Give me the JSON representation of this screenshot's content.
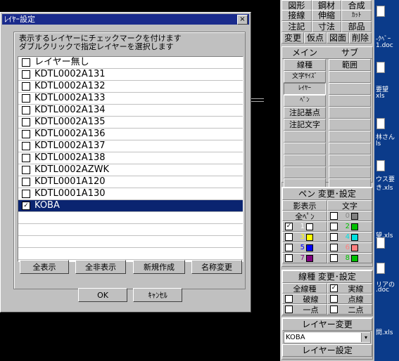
{
  "dialog": {
    "title": "ﾚｲﾔｰ設定",
    "close_label": "×",
    "instructions": [
      "表示するレイヤーにチェックマークを付けます",
      "ダブルクリックで指定レイヤーを選択します"
    ],
    "layers": [
      {
        "name": "レイヤー無し",
        "checked": false,
        "selected": false
      },
      {
        "name": "KDTL0002A131",
        "checked": false,
        "selected": false
      },
      {
        "name": "KDTL0002A132",
        "checked": false,
        "selected": false
      },
      {
        "name": "KDTL0002A133",
        "checked": false,
        "selected": false
      },
      {
        "name": "KDTL0002A134",
        "checked": false,
        "selected": false
      },
      {
        "name": "KDTL0002A135",
        "checked": false,
        "selected": false
      },
      {
        "name": "KDTL0002A136",
        "checked": false,
        "selected": false
      },
      {
        "name": "KDTL0002A137",
        "checked": false,
        "selected": false
      },
      {
        "name": "KDTL0002A138",
        "checked": false,
        "selected": false
      },
      {
        "name": "KDTL0002AZWK",
        "checked": false,
        "selected": false
      },
      {
        "name": "KDTL0001A120",
        "checked": false,
        "selected": false
      },
      {
        "name": "KDTL0001A130",
        "checked": false,
        "selected": false
      },
      {
        "name": "KOBA",
        "checked": true,
        "selected": true
      }
    ],
    "buttons": {
      "show_all": "全表示",
      "hide_all": "全非表示",
      "new": "新規作成",
      "rename": "名称変更",
      "ok": "OK",
      "cancel": "ｷｬﾝｾﾙ"
    }
  },
  "palette": {
    "grid": [
      [
        "図形",
        "鋼材",
        "合成"
      ],
      [
        "接線",
        "伸縮",
        "ｶｯﾄ"
      ],
      [
        "注記",
        "寸法",
        "部品"
      ],
      [
        "変更",
        "仮点",
        "図面",
        "削除"
      ]
    ],
    "main_header": "メイン",
    "sub_header": "サブ",
    "main_items": [
      "線種",
      "文字ｻｲｽﾞ",
      "ﾚｲﾔｰ",
      "ﾍﾟﾝ",
      "注記基点",
      "注記文字"
    ],
    "sub_items": [
      "範囲"
    ],
    "pen_title": "ペン 変更･設定",
    "pen_show": "影表示",
    "pen_text": "文字",
    "pen_all": "全ﾍﾟﾝ",
    "pens": [
      {
        "left": {
          "num": "1",
          "color": "#ffffff",
          "checked": true
        },
        "right": {
          "num": "2",
          "color": "#00c000",
          "checked": false
        }
      },
      {
        "left": {
          "num": "3",
          "color": "#ffff00",
          "checked": false
        },
        "right": {
          "num": "4",
          "color": "#00e0e0",
          "checked": false
        }
      },
      {
        "left": {
          "num": "5",
          "color": "#0000ff",
          "checked": false
        },
        "right": {
          "num": "6",
          "color": "#ff8080",
          "checked": false
        }
      },
      {
        "left": {
          "num": "7",
          "color": "#800080",
          "checked": false
        },
        "right": {
          "num": "8",
          "color": "#00c000",
          "checked": false
        }
      }
    ],
    "line_title": "線種 変更･設定",
    "line_all": "全線種",
    "lines": [
      [
        "実線",
        true
      ],
      [
        "破線",
        false
      ],
      [
        "点線",
        false
      ],
      [
        "一点",
        false
      ],
      [
        "二点",
        false
      ]
    ],
    "layer_change_title": "レイヤー変更",
    "layer_current": "KOBA",
    "layer_setting": "レイヤー設定"
  },
  "desktop": {
    "labels": [
      "-ｸﾍﾞｰ",
      "1.doc",
      "要望",
      "xls",
      "林さん",
      "ls",
      "ウス要",
      "き.xls",
      "望.xls",
      "リアの",
      ".doc",
      "問.xls"
    ]
  },
  "colors": {
    "title_bar": "#1a2b8c",
    "selection": "#0a2470",
    "desktop": "#0b3b8a"
  }
}
